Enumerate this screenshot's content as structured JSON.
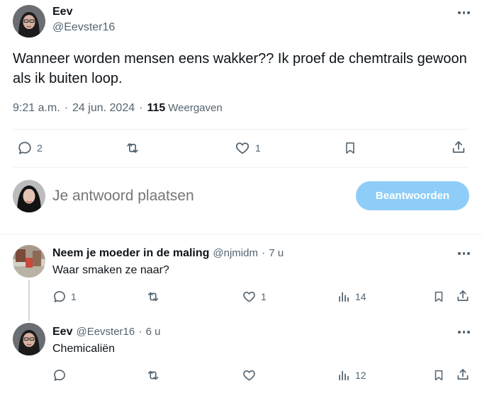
{
  "main_tweet": {
    "author_name": "Eev",
    "handle": "@Eevster16",
    "text": "Wanneer worden mensen eens wakker?? Ik proef de chemtrails gewoon als ik buiten loop.",
    "time": "9:21 a.m.",
    "date": "24 jun. 2024",
    "views_count": "115",
    "views_label": "Weergaven",
    "replies": "2",
    "retweets": "",
    "likes": "1"
  },
  "compose": {
    "placeholder": "Je antwoord plaatsen",
    "button_label": "Beantwoorden"
  },
  "replies": [
    {
      "author_name": "Neem je moeder in de maling",
      "handle": "@njmidm",
      "age": "7 u",
      "text": "Waar smaken ze naar?",
      "replies": "1",
      "retweets": "",
      "likes": "1",
      "views": "14"
    },
    {
      "author_name": "Eev",
      "handle": "@Eevster16",
      "age": "6 u",
      "text": "Chemicaliën",
      "replies": "",
      "retweets": "",
      "likes": "",
      "views": "12"
    }
  ],
  "separator": "·",
  "icons": [
    "more-icon",
    "reply-icon",
    "retweet-icon",
    "like-icon",
    "bookmark-icon",
    "share-icon",
    "views-icon"
  ],
  "colors": {
    "accent_disabled": "#8ecdf8",
    "muted": "#536471",
    "text": "#0f1419"
  }
}
